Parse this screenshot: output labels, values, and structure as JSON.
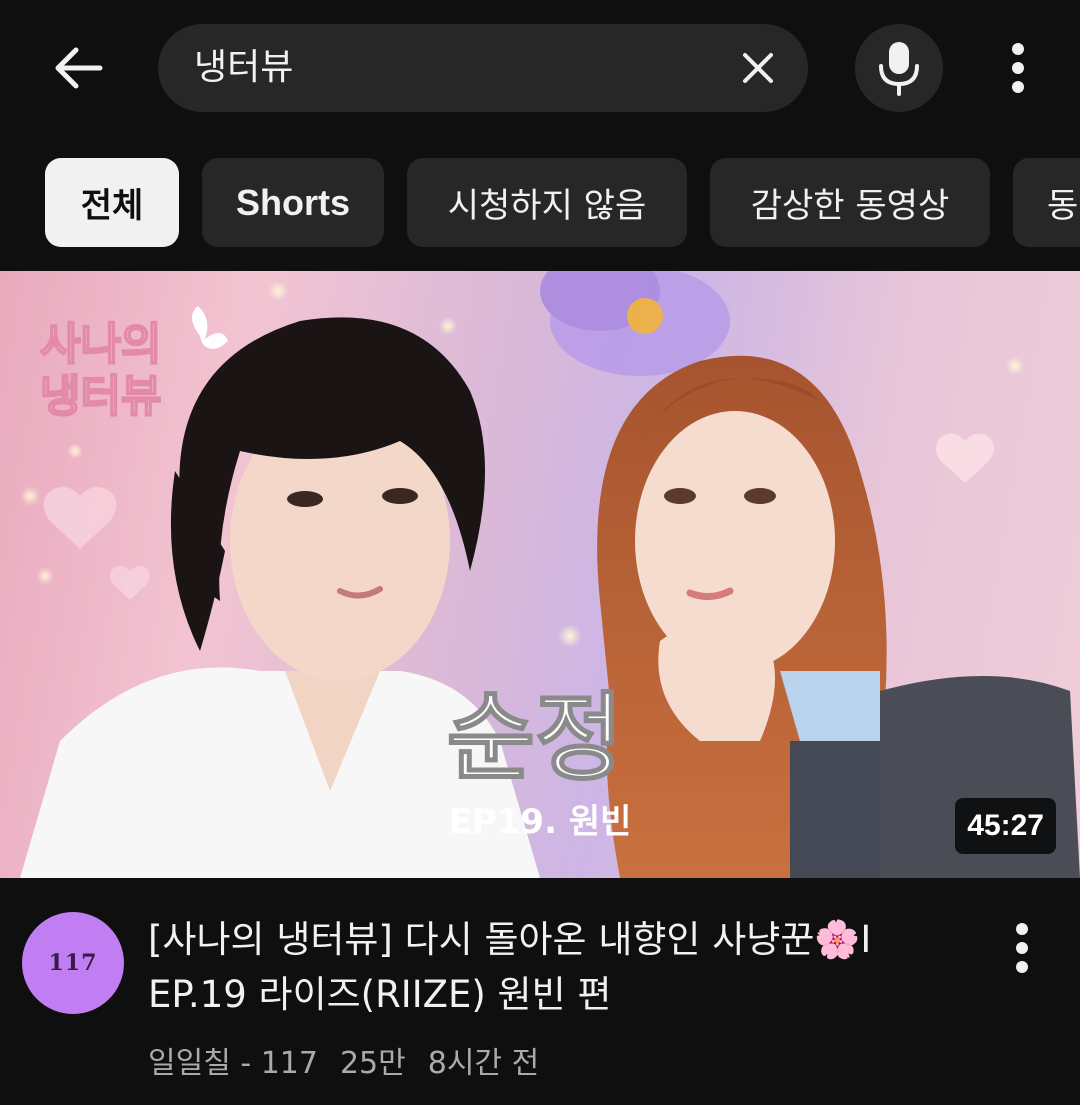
{
  "header": {
    "search_query": "냉터뷰"
  },
  "filters": [
    {
      "label": "전체",
      "active": true
    },
    {
      "label": "Shorts",
      "active": false
    },
    {
      "label": "시청하지 않음",
      "active": false
    },
    {
      "label": "감상한 동영상",
      "active": false
    },
    {
      "label": "동",
      "active": false
    }
  ],
  "video": {
    "thumbnail": {
      "logo_line1": "사나의",
      "logo_line2": "냉터뷰",
      "caption_main": "순정",
      "caption_sub": "EP19. 원빈"
    },
    "duration": "45:27",
    "channel_avatar_text": "117",
    "title_line1": "[사나의 냉터뷰] 다시 돌아온 내향인 사냥꾼🌸I",
    "title_line2": "EP.19 라이즈(RIIZE) 원빈 편",
    "channel": "일일칠 - 117",
    "views": "25만",
    "age": "8시간 전"
  },
  "colors": {
    "background": "#0f0f0f",
    "surface": "#272727",
    "text": "#f1f1f1",
    "secondary_text": "#aaaaaa",
    "avatar": "#c07ef2"
  }
}
